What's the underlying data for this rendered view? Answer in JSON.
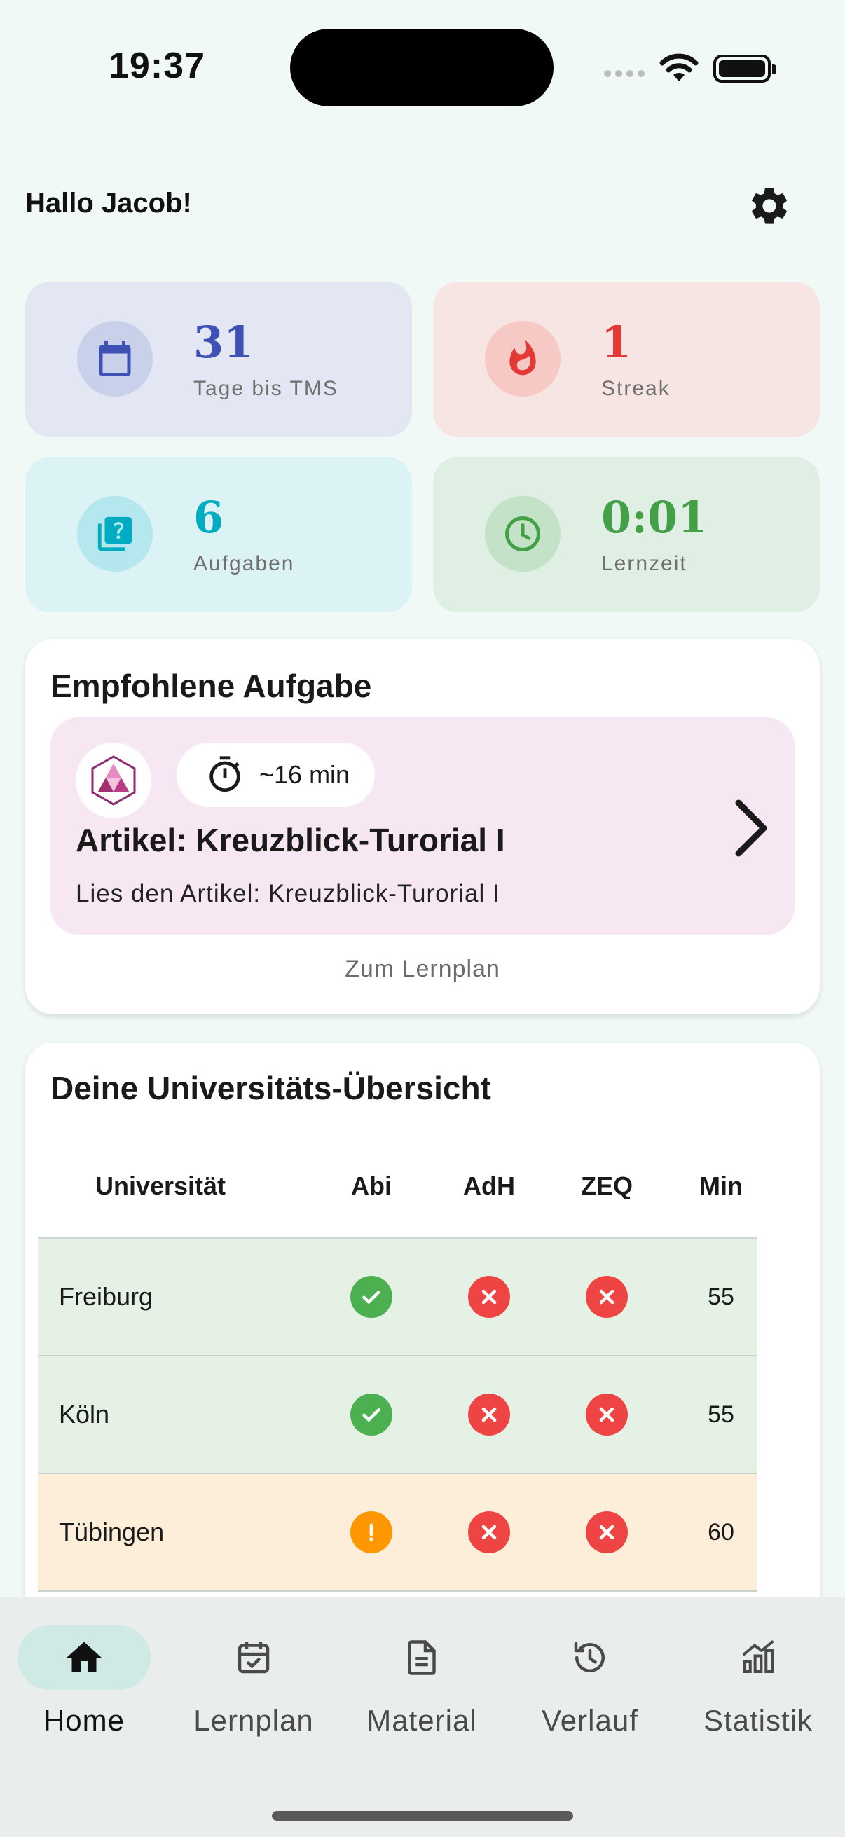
{
  "status_bar": {
    "time": "19:37"
  },
  "header": {
    "greeting": "Hallo Jacob!"
  },
  "stats": [
    {
      "value": "31",
      "label": "Tage bis TMS",
      "icon": "calendar-icon",
      "color": "#3f51b5",
      "bg": "#e2e7f3"
    },
    {
      "value": "1",
      "label": "Streak",
      "icon": "flame-icon",
      "color": "#e53935",
      "bg": "#f6e5e3"
    },
    {
      "value": "6",
      "label": "Aufgaben",
      "icon": "quiz-icon",
      "color": "#00acc1",
      "bg": "#dcf3f5"
    },
    {
      "value": "0:01",
      "label": "Lernzeit",
      "icon": "clock-icon",
      "color": "#43a047",
      "bg": "#e0efe3"
    }
  ],
  "recommended": {
    "title": "Empfohlene Aufgabe",
    "task": {
      "duration": "~16 min",
      "title": "Artikel: Kreuzblick-Turorial I",
      "description": "Lies den Artikel: Kreuzblick-Turorial I"
    },
    "link": "Zum Lernplan"
  },
  "universities": {
    "title": "Deine Universitäts-Übersicht",
    "columns": [
      "Universität",
      "Abi",
      "AdH",
      "ZEQ",
      "Min"
    ],
    "rows": [
      {
        "name": "Freiburg",
        "abi": "ok",
        "adh": "no",
        "zeq": "no",
        "min": "55",
        "highlight": "green"
      },
      {
        "name": "Köln",
        "abi": "ok",
        "adh": "no",
        "zeq": "no",
        "min": "55",
        "highlight": "green"
      },
      {
        "name": "Tübingen",
        "abi": "warn",
        "adh": "no",
        "zeq": "no",
        "min": "60",
        "highlight": "orange"
      }
    ]
  },
  "nav": {
    "active": "Home",
    "items": [
      {
        "label": "Home",
        "icon": "home-icon"
      },
      {
        "label": "Lernplan",
        "icon": "calendar-check-icon"
      },
      {
        "label": "Material",
        "icon": "document-icon"
      },
      {
        "label": "Verlauf",
        "icon": "history-icon"
      },
      {
        "label": "Statistik",
        "icon": "chart-icon"
      }
    ]
  }
}
